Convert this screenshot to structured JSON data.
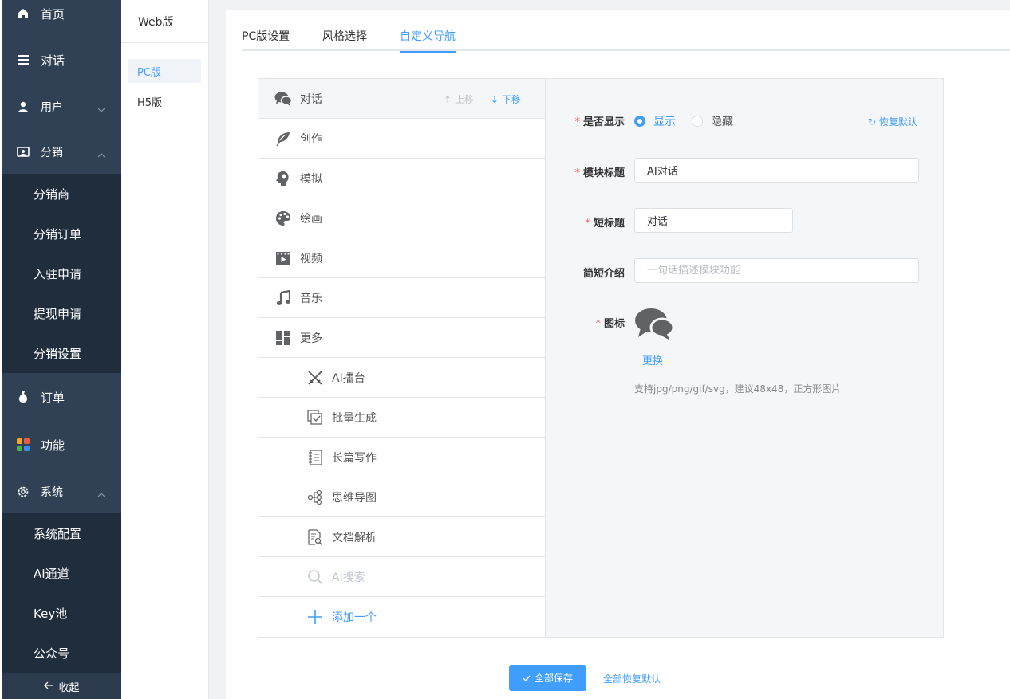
{
  "sidebar": {
    "items": [
      {
        "label": "首页",
        "icon": "home-icon"
      },
      {
        "label": "对话",
        "icon": "menu-icon"
      },
      {
        "label": "用户",
        "icon": "user-icon"
      },
      {
        "label": "分销",
        "icon": "id-card-icon"
      },
      {
        "label": "订单",
        "icon": "money-bag-icon"
      },
      {
        "label": "功能",
        "icon": "grid-icon"
      },
      {
        "label": "系统",
        "icon": "gear-icon"
      }
    ],
    "distribution_sub": [
      "分销商",
      "分销订单",
      "入驻申请",
      "提现申请",
      "分销设置"
    ],
    "system_sub": [
      "系统配置",
      "AI通道",
      "Key池",
      "公众号"
    ],
    "collapse_label": "收起"
  },
  "platform": {
    "title": "Web版",
    "options": [
      "PC版",
      "H5版"
    ],
    "selected": "PC版"
  },
  "tabs": [
    {
      "label": "PC版设置"
    },
    {
      "label": "风格选择"
    },
    {
      "label": "自定义导航"
    }
  ],
  "active_tab": "自定义导航",
  "nav_list": {
    "move_up": "上移",
    "move_down": "下移",
    "items": [
      {
        "label": "对话",
        "icon": "chat-bubbles-icon"
      },
      {
        "label": "创作",
        "icon": "feather-icon"
      },
      {
        "label": "模拟",
        "icon": "head-profile-icon"
      },
      {
        "label": "绘画",
        "icon": "palette-icon"
      },
      {
        "label": "视频",
        "icon": "video-icon"
      },
      {
        "label": "音乐",
        "icon": "music-note-icon"
      },
      {
        "label": "更多",
        "icon": "dashboard-icon"
      },
      {
        "label": "AI擂台",
        "icon": "crossed-swords-icon"
      },
      {
        "label": "批量生成",
        "icon": "batch-check-icon"
      },
      {
        "label": "长篇写作",
        "icon": "notebook-icon"
      },
      {
        "label": "思维导图",
        "icon": "mind-map-icon"
      },
      {
        "label": "文档解析",
        "icon": "document-search-icon"
      },
      {
        "label": "AI搜索",
        "icon": "search-icon"
      }
    ],
    "add_label": "添加一个"
  },
  "form": {
    "show_label": "是否显示",
    "show_option": "显示",
    "hide_option": "隐藏",
    "restore_default": "恢复默认",
    "title_label": "模块标题",
    "title_value": "AI对话",
    "short_label": "短标题",
    "short_value": "对话",
    "intro_label": "简短介绍",
    "intro_placeholder": "一句话描述模块功能",
    "icon_label": "图标",
    "change_label": "更换",
    "hint": "支持jpg/png/gif/svg，建议48x48，正方形图片"
  },
  "footer": {
    "save_all": "全部保存",
    "restore_all": "全部恢复默认"
  },
  "colors": {
    "primary": "#409eff",
    "sidebar_bg": "#304156",
    "submenu_bg": "#1f2d3d",
    "required": "#f56c6c"
  }
}
